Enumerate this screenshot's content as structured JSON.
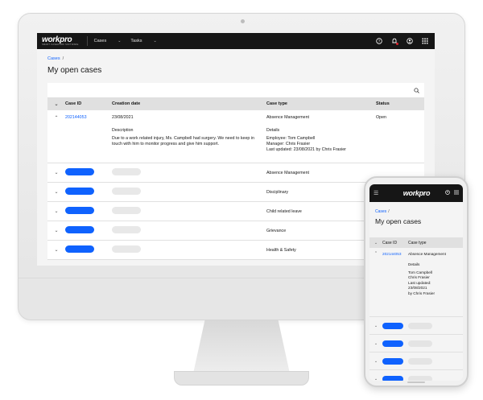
{
  "app": {
    "logo": "workpro",
    "logo_tagline": "SMART CASEWORK SOFTWARE",
    "nav": [
      {
        "label": "Cases"
      },
      {
        "label": "Tasks"
      }
    ],
    "icons": [
      "help-icon",
      "notification-bell-icon",
      "user-profile-icon",
      "app-switcher-icon"
    ]
  },
  "page": {
    "breadcrumb": "Cases",
    "breadcrumb_sep": "/",
    "title": "My open cases"
  },
  "table": {
    "columns": [
      "Case ID",
      "Creation date",
      "Case type",
      "Status"
    ],
    "expanded": {
      "case_id": "202144053",
      "creation_date": "23/08/2021",
      "case_type": "Absence Management",
      "status": "Open",
      "description_label": "Description",
      "description": "Due to a work related injury, Ms. Campbell had surgery. We need to keep in touch with him to monitor progress and give him support.",
      "details_label": "Details",
      "details": [
        "Employee: Tom Campbell",
        "Manager: Chris Frasier",
        "Last updated: 23/08/2021 by Chris Frasier"
      ]
    },
    "rows": [
      {
        "case_type": "Absence Management"
      },
      {
        "case_type": "Disciplinary"
      },
      {
        "case_type": "Child related leave"
      },
      {
        "case_type": "Grievance"
      },
      {
        "case_type": "Health & Safety"
      }
    ]
  },
  "mobile": {
    "logo": "workpro",
    "breadcrumb": "Cases",
    "breadcrumb_sep": "/",
    "title": "My open cases",
    "columns": [
      "Case ID",
      "Case type"
    ],
    "expanded": {
      "case_id": "202144053",
      "case_type": "Absence Management",
      "details_label": "Details",
      "details": [
        "Tom Campbell",
        "Chris Frasier",
        "Last updated:",
        "23/08/2021",
        "by Chris Frasier"
      ]
    }
  },
  "colors": {
    "accent": "#0f62fe",
    "header_bg": "#161616",
    "table_header": "#e0e0e0",
    "page_bg": "#f4f4f4",
    "notification": "#da1e28"
  }
}
